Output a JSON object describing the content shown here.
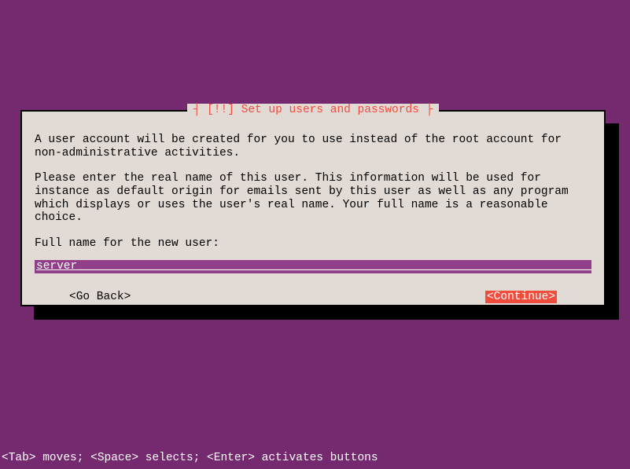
{
  "dialog": {
    "title_prefix": "┤ ",
    "title_marker": "[!!]",
    "title_text": "Set up users and passwords",
    "title_suffix": " ├",
    "para1": "A user account will be created for you to use instead of the root account for non-administrative activities.",
    "para2": "Please enter the real name of this user. This information will be used for instance as default origin for emails sent by this user as well as any program which displays or uses the user's real name. Your full name is a reasonable choice.",
    "prompt": "Full name for the new user:",
    "input_value": "server",
    "go_back_label": "<Go Back>",
    "continue_label": "<Continue>"
  },
  "status_bar": "<Tab> moves; <Space> selects; <Enter> activates buttons"
}
